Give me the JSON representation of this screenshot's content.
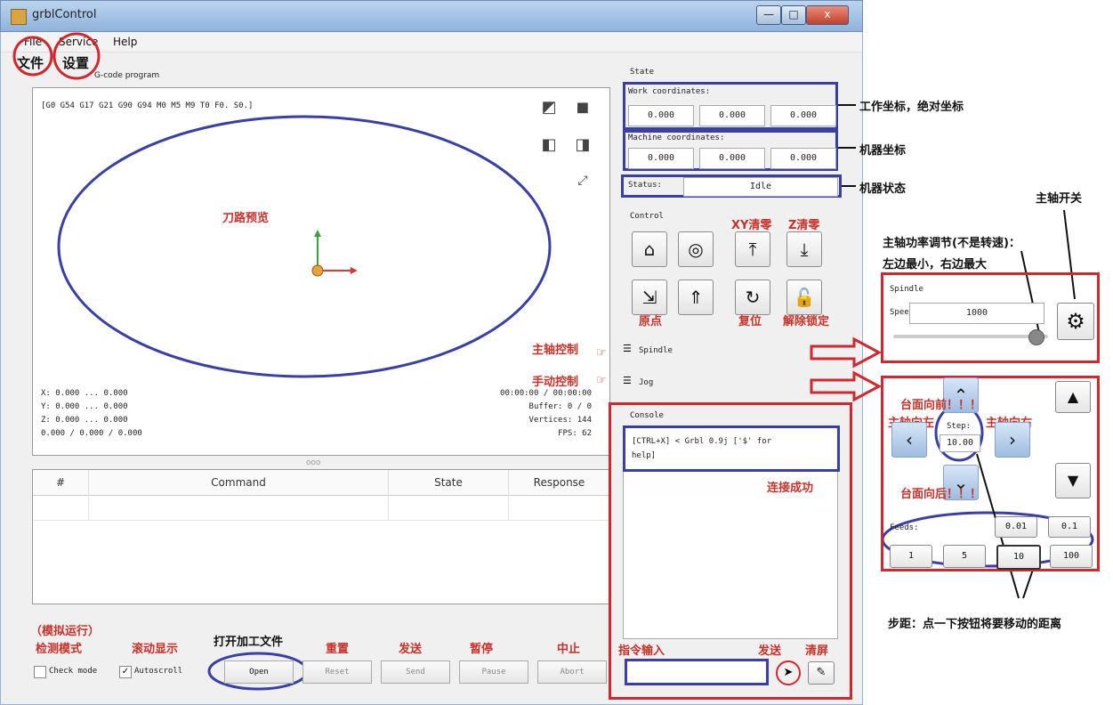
{
  "window": {
    "title": "grblControl",
    "min": "—",
    "max": "□",
    "close": "x"
  },
  "menu": {
    "file": "File",
    "service": "Service",
    "help": "Help",
    "file_cn": "文件",
    "service_cn": "设置"
  },
  "preview": {
    "header_label": "G-code program",
    "gcode_state": "[G0 G54 G17 G21 G90 G94 M0 M5 M9 T0 F0. S0.]",
    "coords": [
      "X: 0.000 ... 0.000",
      "Y: 0.000 ... 0.000",
      "Z: 0.000 ... 0.000",
      "0.000 / 0.000 / 0.000"
    ],
    "stats": [
      "00:00:00 / 00:00:00",
      "Buffer: 0 / 0",
      "Vertices: 144",
      "FPS: 62"
    ],
    "annotation_cn": "刀路预览"
  },
  "table": {
    "splitter": "ooo",
    "columns": [
      "#",
      "Command",
      "State",
      "Response"
    ]
  },
  "state": {
    "title": "State",
    "work_label": "Work coordinates:",
    "work": [
      "0.000",
      "0.000",
      "0.000"
    ],
    "machine_label": "Machine coordinates:",
    "machine": [
      "0.000",
      "0.000",
      "0.000"
    ],
    "status_label": "Status:",
    "status_value": "Idle"
  },
  "control": {
    "title": "Control",
    "ann_xy": "XY清零",
    "ann_z": "Z清零",
    "ann_home": "原点",
    "ann_reset": "复位",
    "ann_unlock": "解除锁定",
    "icons_row1": [
      "⌂",
      "◎",
      "⤒",
      "⤓"
    ],
    "icons_row2": [
      "⇲",
      "⇑",
      "↻",
      "🔓"
    ]
  },
  "sections": {
    "spindle": "Spindle",
    "jog": "Jog",
    "spindle_cn": "主轴控制",
    "jog_cn": "手动控制",
    "menu_icon": "☰"
  },
  "console": {
    "title": "Console",
    "text": "[CTRL+X] < Grbl 0.9j ['$' for help]",
    "ann_connected": "连接成功",
    "ann_input": "指令输入",
    "ann_send": "发送",
    "ann_clear": "清屏"
  },
  "bottom": {
    "check_mode": "Check mode",
    "autoscroll": "Autoscroll",
    "open": "Open",
    "reset": "Reset",
    "send": "Send",
    "pause": "Pause",
    "abort": "Abort",
    "ann_check1": "（模拟运行）",
    "ann_check2": "检测模式",
    "ann_autoscroll": "滚动显示",
    "ann_open": "打开加工文件",
    "ann_reset": "重置",
    "ann_send": "发送",
    "ann_pause": "暂停",
    "ann_abort": "中止"
  },
  "spindle_panel": {
    "title": "Spindle",
    "speed_label": "Speed:",
    "speed_value": "1000",
    "speed_fraction": 0.92,
    "ann_switch": "主轴开关",
    "ann_power1": "主轴功率调节(不是转速)：",
    "ann_power2": "左边最小，右边最大"
  },
  "jog_panel": {
    "step_label": "Step:",
    "step_value": "10.00",
    "feeds_label": "Feeds:",
    "feeds": [
      "0.01",
      "0.1"
    ],
    "steps": [
      "1",
      "5",
      "10",
      "100"
    ],
    "ann_forward": "台面向前！！！",
    "ann_back": "台面向后！！！",
    "ann_left": "主轴向左",
    "ann_right": "主轴向右",
    "ann_steps": "步距：点一下按钮将要移动的距离"
  },
  "annotations": {
    "work_coords": "工作坐标，绝对坐标",
    "machine_coords": "机器坐标",
    "machine_status": "机器状态"
  }
}
